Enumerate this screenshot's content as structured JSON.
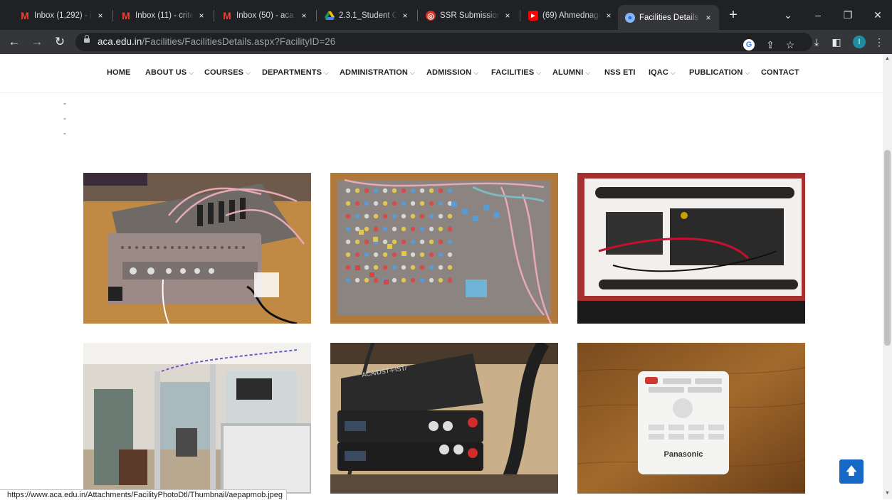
{
  "browser": {
    "tabs": [
      {
        "title": "Inbox (1,292) - ic",
        "icon": "gmail-icon",
        "active": false
      },
      {
        "title": "Inbox (11) - crite",
        "icon": "gmail-icon",
        "active": false
      },
      {
        "title": "Inbox (50) - aca.e",
        "icon": "gmail-icon",
        "active": false
      },
      {
        "title": "2.3.1_Student Ce",
        "icon": "google-drive-icon",
        "active": false
      },
      {
        "title": "SSR Submission",
        "icon": "ssr-icon",
        "active": false
      },
      {
        "title": "(69) Ahmednagar",
        "icon": "youtube-icon",
        "active": true
      },
      {
        "title": "Facilities Details",
        "icon": "facility-icon",
        "active": true
      }
    ],
    "tab_close_glyph": "×",
    "new_tab_glyph": "+",
    "url_host": "aca.edu.in",
    "url_path": "/Facilities/FacilitiesDetails.aspx?FacilityID=26",
    "profile_initial": "I",
    "status_url": "https://www.aca.edu.in/Attachments/FacilityPhotoDtl/Thumbnail/aepapmob.jpeg"
  },
  "nav": {
    "home": "HOME",
    "about": "ABOUT US",
    "courses": "COURSES",
    "departments": "DEPARTMENTS",
    "administration": "ADMINISTRATION",
    "admission": "ADMISSION",
    "facilities": "FACILITIES",
    "alumni": "ALUMNI",
    "nss": "NSS ETI",
    "iqac": "IQAC",
    "publication": "PUBLICATION",
    "contact": "CONTACT"
  },
  "content": {
    "dash_items": [
      "-",
      "-",
      "-"
    ],
    "photos": [
      {
        "subject": "audio mixer console with cables"
      },
      {
        "subject": "audio mixer top view"
      },
      {
        "subject": "wireless microphone case"
      },
      {
        "subject": "studio room cabins"
      },
      {
        "subject": "wireless receivers ACA/DST-FIST"
      },
      {
        "subject": "Panasonic projector remote"
      }
    ],
    "receiver_label": "ACA/DST-FIST/",
    "remote_brand": "Panasonic"
  }
}
